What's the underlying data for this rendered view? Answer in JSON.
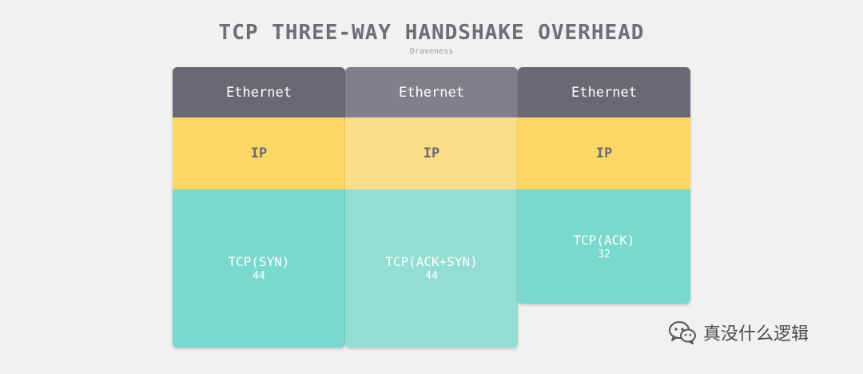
{
  "diagram": {
    "title": "TCP THREE-WAY HANDSHAKE OVERHEAD",
    "subtitle": "Draveness",
    "packets": [
      {
        "ethernet": "Ethernet",
        "ip": "IP",
        "tcp_label": "TCP(SYN)",
        "tcp_size": "44"
      },
      {
        "ethernet": "Ethernet",
        "ip": "IP",
        "tcp_label": "TCP(ACK+SYN)",
        "tcp_size": "44"
      },
      {
        "ethernet": "Ethernet",
        "ip": "IP",
        "tcp_label": "TCP(ACK)",
        "tcp_size": "32"
      }
    ]
  },
  "watermark": {
    "text": "真没什么逻辑",
    "icon": "wechat-icon"
  },
  "colors": {
    "ethernet": "#6a6873",
    "ip": "#fcd766",
    "tcp": "#79d9cd",
    "background": "#f1f1f2"
  }
}
